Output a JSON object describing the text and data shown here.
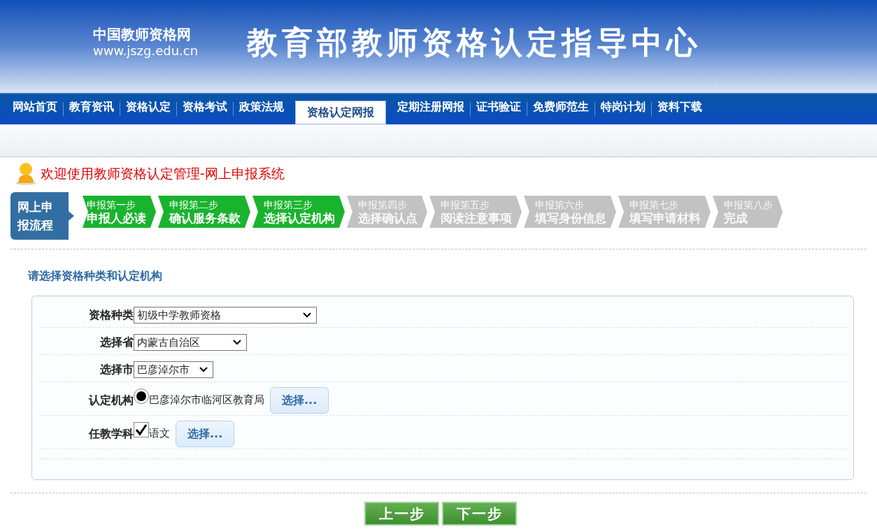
{
  "header": {
    "site_name": "中国教师资格网",
    "site_url": "www.jszg.edu.cn",
    "title": "教育部教师资格认定指导中心"
  },
  "nav": [
    {
      "label": "网站首页",
      "selected": false
    },
    {
      "label": "教育资讯",
      "selected": false
    },
    {
      "label": "资格认定",
      "selected": false
    },
    {
      "label": "资格考试",
      "selected": false
    },
    {
      "label": "政策法规",
      "selected": false
    },
    {
      "label": "资格认定网报",
      "selected": true
    },
    {
      "label": "定期注册网报",
      "selected": false
    },
    {
      "label": "证书验证",
      "selected": false
    },
    {
      "label": "免费师范生",
      "selected": false
    },
    {
      "label": "特岗计划",
      "selected": false
    },
    {
      "label": "资料下载",
      "selected": false
    }
  ],
  "welcome": "欢迎使用教师资格认定管理-网上申报系统",
  "process": {
    "label": "网上申报流程",
    "steps": [
      {
        "step": "申报第一步",
        "name": "申报人必读",
        "done": true
      },
      {
        "step": "申报第二步",
        "name": "确认服务条款",
        "done": true
      },
      {
        "step": "申报第三步",
        "name": "选择认定机构",
        "done": true
      },
      {
        "step": "申报第四步",
        "name": "选择确认点",
        "done": false
      },
      {
        "step": "申报第五步",
        "name": "阅读注意事项",
        "done": false
      },
      {
        "step": "申报第六步",
        "name": "填写身份信息",
        "done": false
      },
      {
        "step": "申报第七步",
        "name": "填写申请材料",
        "done": false
      },
      {
        "step": "申报第八步",
        "name": "完成",
        "done": false
      }
    ]
  },
  "section_title": "请选择资格种类和认定机构",
  "form": [
    {
      "kind": "select",
      "label": "资格种类",
      "value": "初级中学教师资格"
    },
    {
      "kind": "select",
      "label": "选择省",
      "value": "内蒙古自治区"
    },
    {
      "kind": "select",
      "label": "选择市",
      "value": "巴彦淖尔市"
    },
    {
      "kind": "radio",
      "label": "认定机构",
      "option": "巴彦淖尔市临河区教育局",
      "selected": true,
      "button": "选择..."
    },
    {
      "kind": "checkbox",
      "label": "任教学科",
      "option": "语文",
      "checked": true,
      "button": "选择..."
    }
  ],
  "buttons": [
    "上一步",
    "下一步"
  ]
}
